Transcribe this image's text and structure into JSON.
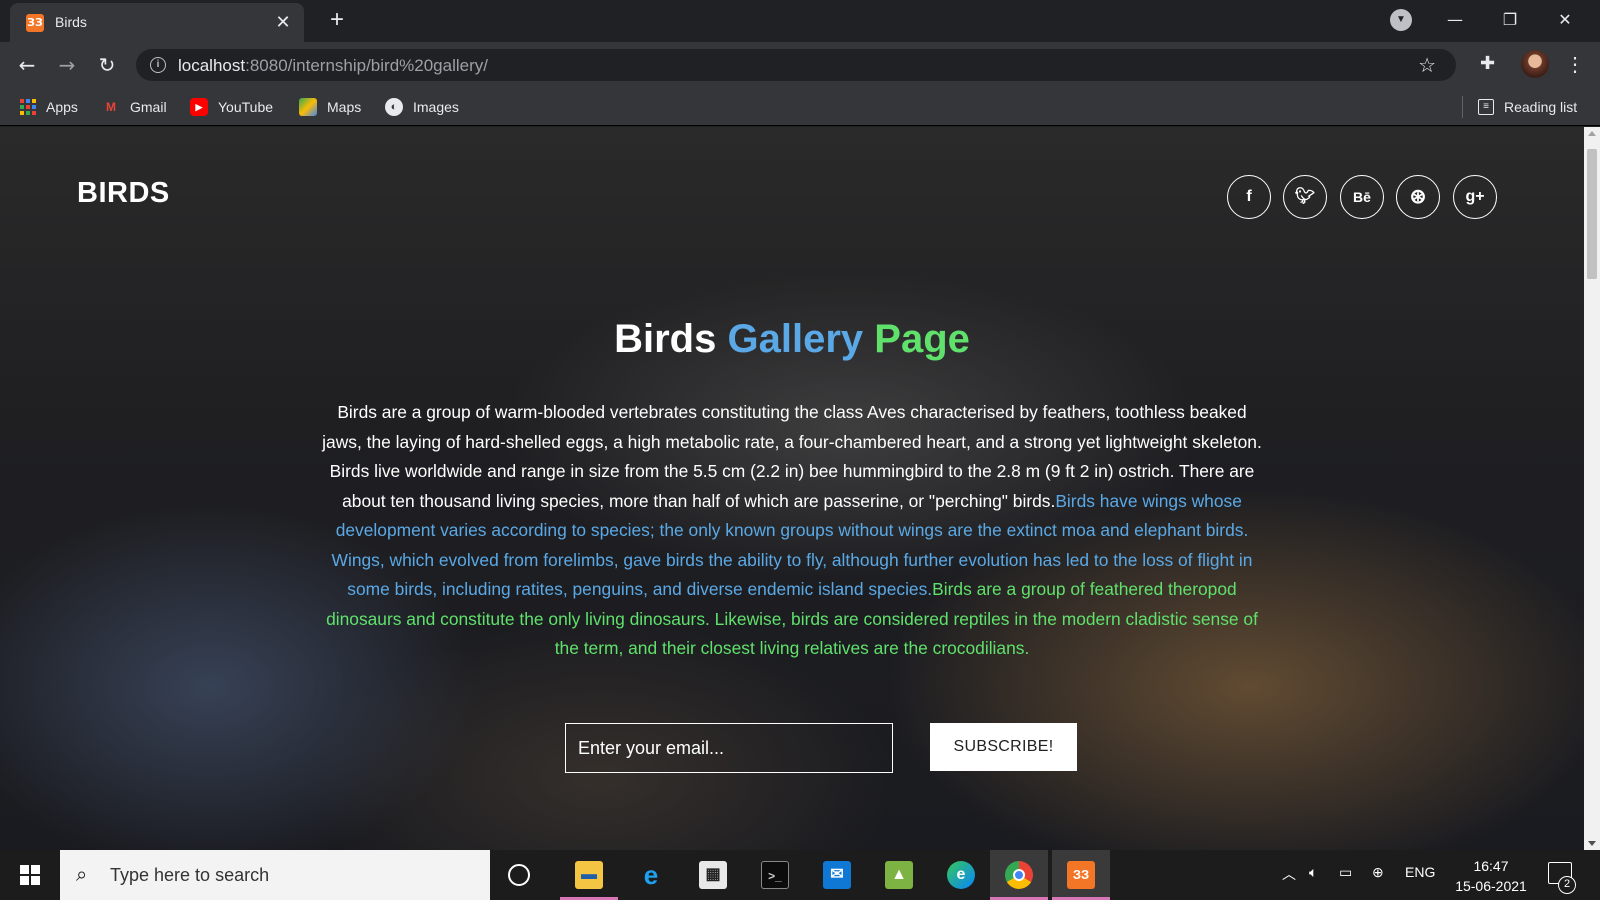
{
  "browser": {
    "tab_title": "Birds",
    "tab_favicon": "xampp-icon",
    "url_host": "localhost",
    "url_rest": ":8080/internship/bird%20gallery/",
    "bookmarks": [
      {
        "label": "Apps",
        "icon": "apps-grid-icon"
      },
      {
        "label": "Gmail",
        "icon": "gmail-icon"
      },
      {
        "label": "YouTube",
        "icon": "youtube-icon"
      },
      {
        "label": "Maps",
        "icon": "maps-icon"
      },
      {
        "label": "Images",
        "icon": "images-icon"
      }
    ],
    "reading_list": "Reading list"
  },
  "page": {
    "logo": "BIRDS",
    "social": [
      {
        "name": "facebook",
        "glyph": "f"
      },
      {
        "name": "twitter",
        "glyph": "t"
      },
      {
        "name": "behance",
        "glyph": "Bē"
      },
      {
        "name": "dribbble",
        "glyph": "⊛"
      },
      {
        "name": "google-plus",
        "glyph": "g+"
      }
    ],
    "headline": {
      "word1": "Birds",
      "word2": "Gallery",
      "word3": "Page"
    },
    "paragraph": {
      "white": "Birds are a group of warm-blooded vertebrates constituting the class Aves characterised by feathers, toothless beaked jaws, the laying of hard-shelled eggs, a high metabolic rate, a four-chambered heart, and a strong yet lightweight skeleton. Birds live worldwide and range in size from the 5.5 cm (2.2 in) bee hummingbird to the 2.8 m (9 ft 2 in) ostrich. There are about ten thousand living species, more than half of which are passerine, or \"perching\" birds.",
      "blue": "Birds have wings whose development varies according to species; the only known groups without wings are the extinct moa and elephant birds. Wings, which evolved from forelimbs, gave birds the ability to fly, although further evolution has led to the loss of flight in some birds, including ratites, penguins, and diverse endemic island species.",
      "green": "Birds are a group of feathered theropod dinosaurs and constitute the only living dinosaurs. Likewise, birds are considered reptiles in the modern cladistic sense of the term, and their closest living relatives are the crocodilians."
    },
    "email_placeholder": "Enter your email...",
    "subscribe_label": "SUBSCRIBE!"
  },
  "taskbar": {
    "search_placeholder": "Type here to search",
    "language": "ENG",
    "time": "16:47",
    "date": "15-06-2021",
    "notification_count": "2"
  },
  "colors": {
    "accent_blue": "#5aa9e6",
    "accent_green": "#5fe16b"
  }
}
